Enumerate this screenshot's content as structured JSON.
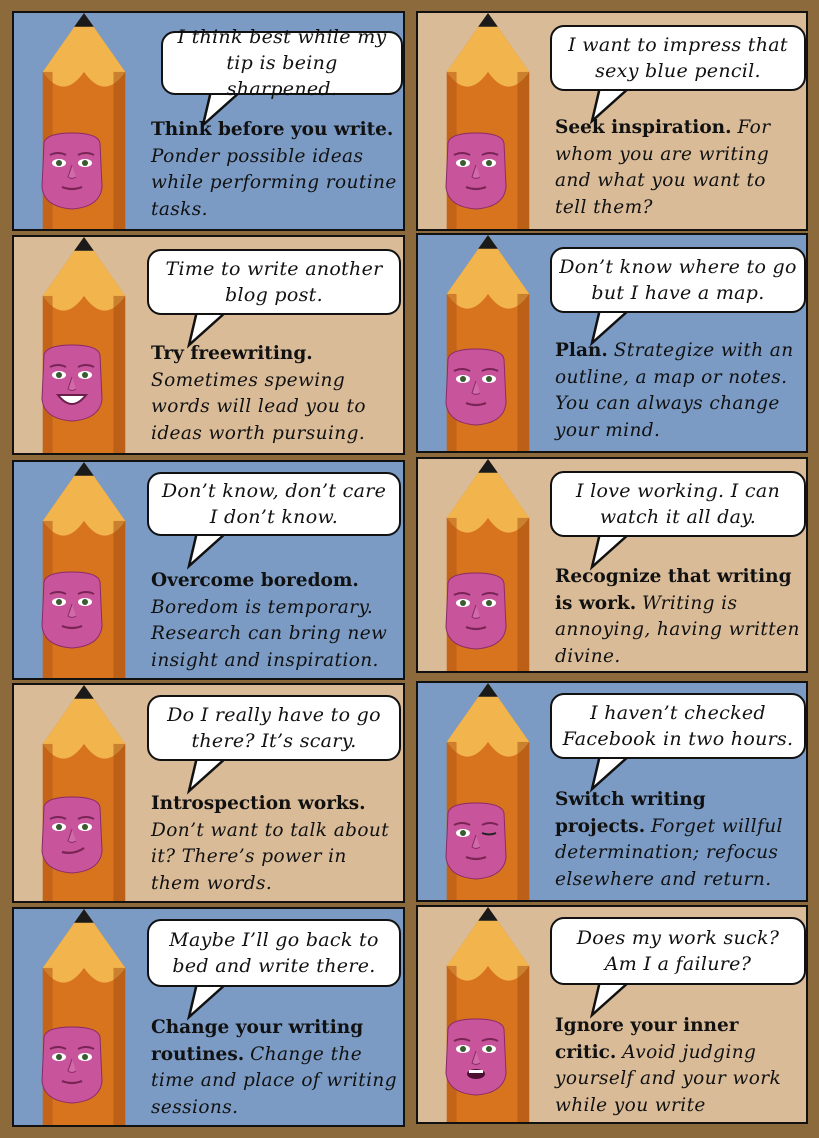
{
  "panels": [
    {
      "bg": "blue",
      "speech": "I think best while my tip is being sharpened.",
      "heading": "Think before you write.",
      "text": "Ponder possible ideas while performing routine tasks.",
      "face": "neutral-smile"
    },
    {
      "bg": "tan",
      "speech": "I want to impress that sexy blue pencil.",
      "heading": "Seek inspiration.",
      "text": "For whom you are writing and what you want to tell them?",
      "face": "sly"
    },
    {
      "bg": "tan",
      "speech": "Time to write another blog post.",
      "heading": "Try freewriting.",
      "text": "Sometimes spewing words will lead you to ideas worth pursuing.",
      "face": "grin"
    },
    {
      "bg": "blue",
      "speech": "Don’t know where to go but I have a map.",
      "heading": "Plan.",
      "text": "Strategize with an outline, a map or notes. You can always change your mind.",
      "face": "neutral"
    },
    {
      "bg": "blue",
      "speech": "Don’t know, don’t care I don’t know.",
      "heading": "Overcome boredom.",
      "text": "Boredom is temporary. Research can bring new insight and inspiration.",
      "face": "bored"
    },
    {
      "bg": "tan",
      "speech": "I love working. I can watch it all day.",
      "heading": "Recognize that writing is work.",
      "text": "Writing is annoying, having written divine.",
      "face": "neutral"
    },
    {
      "bg": "tan",
      "speech": "Do I really have to go there? It’s scary.",
      "heading": "Introspection works.",
      "text": "Don’t want to talk about it? There’s power in them words.",
      "face": "smirk"
    },
    {
      "bg": "blue",
      "speech": "I haven’t checked Facebook in two hours.",
      "heading": "Switch writing projects.",
      "text": "Forget willful determination; refocus elsewhere and return.",
      "face": "wink"
    },
    {
      "bg": "blue",
      "speech": "Maybe I’ll go back to bed and write there.",
      "heading": "Change your writing routines.",
      "text": "Change the time and place of writing sessions.",
      "face": "smile"
    },
    {
      "bg": "tan",
      "speech": "Does my work suck? Am I a failure?",
      "heading": "Ignore your inner critic.",
      "text": "Avoid judging yourself and your work while you write",
      "face": "worried"
    }
  ],
  "colors": {
    "blue_panel": "#7b9bc5",
    "tan_panel": "#d9bb98",
    "frame": "#8c6a3c",
    "pencil_body": "#d8731e",
    "pencil_wood": "#f2b54e",
    "pencil_lead": "#1a1a1a",
    "face": "#c8559c"
  }
}
